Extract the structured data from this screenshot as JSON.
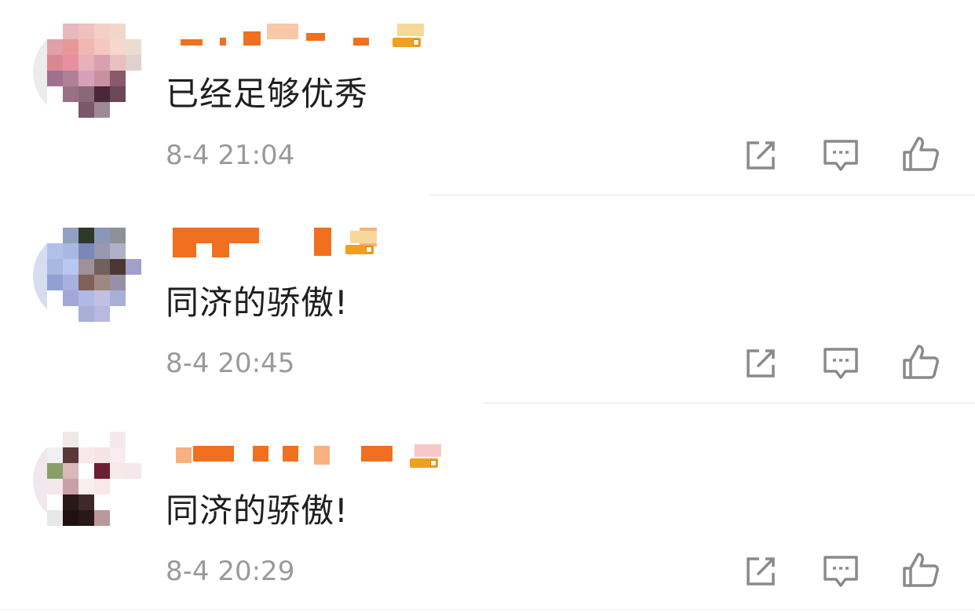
{
  "comments": [
    {
      "text": "已经足够优秀",
      "time": "8-4 21:04"
    },
    {
      "text": "同济的骄傲!",
      "time": "8-4 20:45"
    },
    {
      "text": "同济的骄傲!",
      "time": "8-4 20:29"
    }
  ],
  "colors": {
    "username_redacted": "#f07020",
    "badge": "#f0a020",
    "time": "#9a9a9a",
    "icon": "#8a8a8a",
    "divider": "#e6e6e6"
  },
  "icons": [
    "share-icon",
    "reply-icon",
    "like-icon"
  ]
}
